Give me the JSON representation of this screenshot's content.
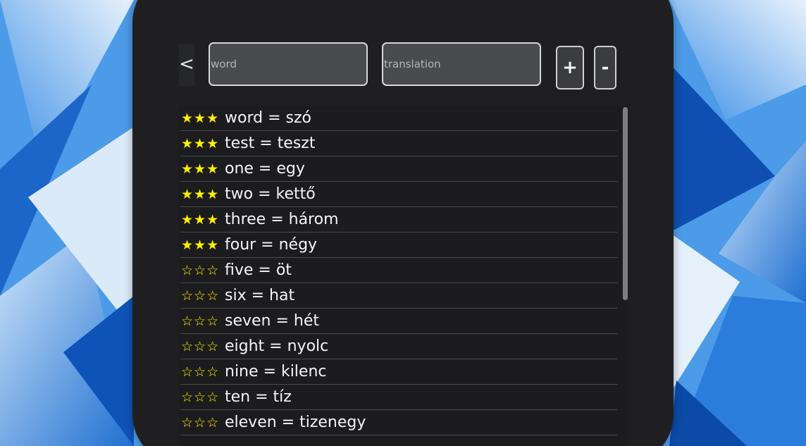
{
  "header": {
    "back_label": "<",
    "word_placeholder": "word",
    "translation_placeholder": "translation",
    "add_label": "+",
    "remove_label": "-"
  },
  "words": [
    {
      "stars": "★★★",
      "text": "word = szó",
      "rating": 3
    },
    {
      "stars": "★★★",
      "text": "test = teszt",
      "rating": 3
    },
    {
      "stars": "★★★",
      "text": "one = egy",
      "rating": 3
    },
    {
      "stars": "★★★",
      "text": "two = kettő",
      "rating": 3
    },
    {
      "stars": "★★★",
      "text": "three = három",
      "rating": 3
    },
    {
      "stars": "★★★",
      "text": "four = négy",
      "rating": 3
    },
    {
      "stars": "☆☆☆",
      "text": "five = öt",
      "rating": 0
    },
    {
      "stars": "☆☆☆",
      "text": "six = hat",
      "rating": 0
    },
    {
      "stars": "☆☆☆",
      "text": "seven = hét",
      "rating": 0
    },
    {
      "stars": "☆☆☆",
      "text": "eight = nyolc",
      "rating": 0
    },
    {
      "stars": "☆☆☆",
      "text": "nine = kilenc",
      "rating": 0
    },
    {
      "stars": "☆☆☆",
      "text": "ten = tíz",
      "rating": 0
    },
    {
      "stars": "☆☆☆",
      "text": "eleven = tizenegy",
      "rating": 0
    }
  ],
  "colors": {
    "star": "#ffee00",
    "panel": "#1f1f21",
    "text": "#f5f5f5"
  }
}
